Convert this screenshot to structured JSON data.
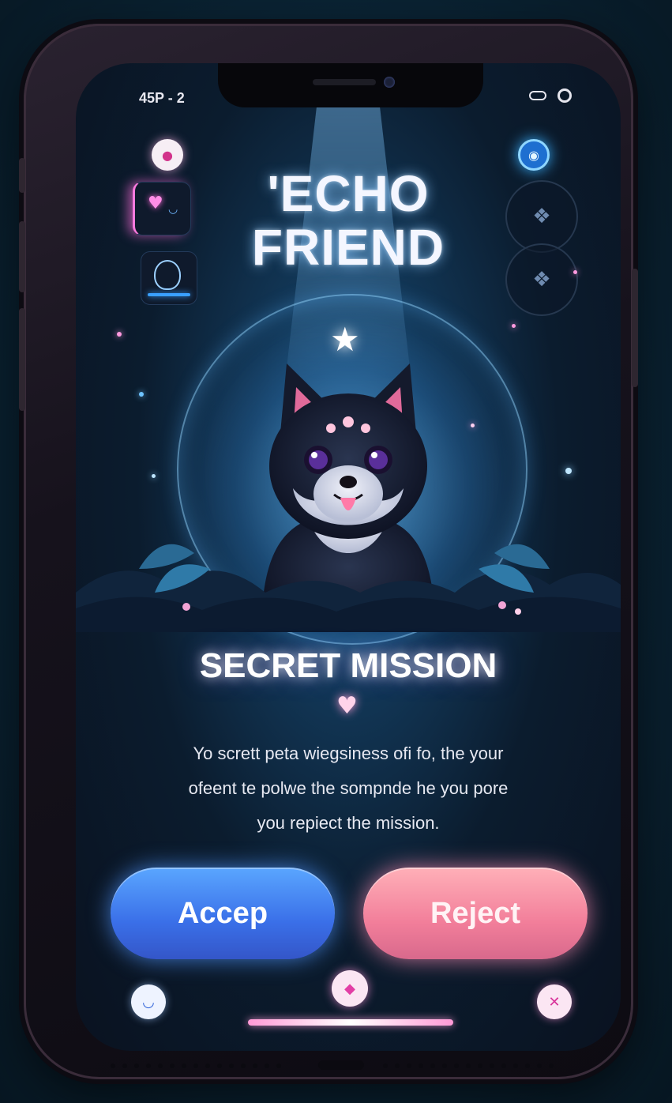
{
  "status": {
    "time": "45P - 2"
  },
  "header": {
    "title_line1": "'ECHO",
    "title_line2": "FRIEND"
  },
  "mission": {
    "title": "SECRET MISSION",
    "description_line1": "Yo scrett peta wiegsiness ofi fo, the your",
    "description_line2": "ofeent te polwe the sompnde he you pore",
    "description_line3": "you repiect the mission."
  },
  "actions": {
    "accept_label": "Accep",
    "reject_label": "Reject"
  },
  "colors": {
    "accept": "#3a6fe8",
    "reject": "#f27e9a",
    "background": "#0b1c2e",
    "glow": "#5ab4ff"
  },
  "icons": {
    "top_left": "profile-icon",
    "top_right": "notification-icon",
    "thumb1": "heart-icon",
    "thumb2": "pet-icon",
    "side1": "pet-photo-icon",
    "side2": "pet-photo-icon",
    "nav_left": "smile-icon",
    "nav_center": "chat-icon",
    "nav_right": "close-icon"
  }
}
